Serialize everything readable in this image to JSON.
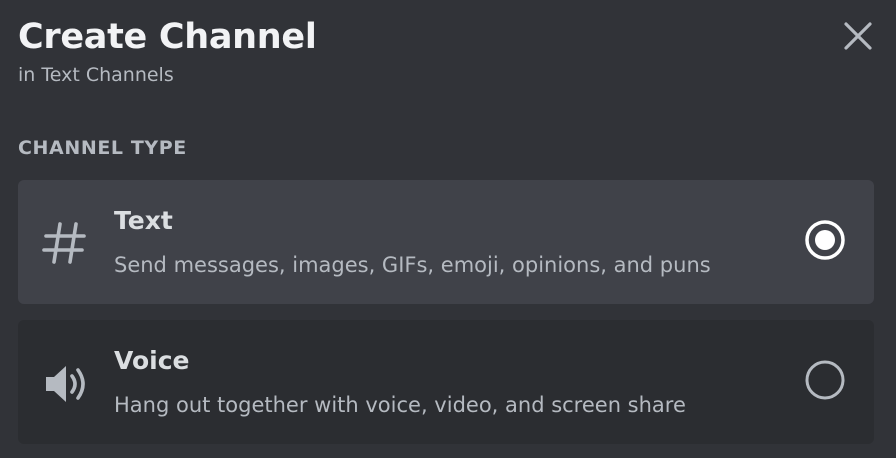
{
  "modal": {
    "title": "Create Channel",
    "subtitle": "in Text Channels",
    "close_icon": "close-icon"
  },
  "channel_type": {
    "label": "CHANNEL TYPE",
    "options": [
      {
        "icon": "hash-icon",
        "name": "Text",
        "description": "Send messages, images, GIFs, emoji, opinions, and puns",
        "selected": true
      },
      {
        "icon": "speaker-icon",
        "name": "Voice",
        "description": "Hang out together with voice, video, and screen share",
        "selected": false
      }
    ]
  },
  "colors": {
    "background": "#313338",
    "selected_option_bg": "#404249",
    "option_bg": "#2b2d31",
    "heading_text": "#f2f3f5",
    "muted_text": "#b5bac1"
  }
}
